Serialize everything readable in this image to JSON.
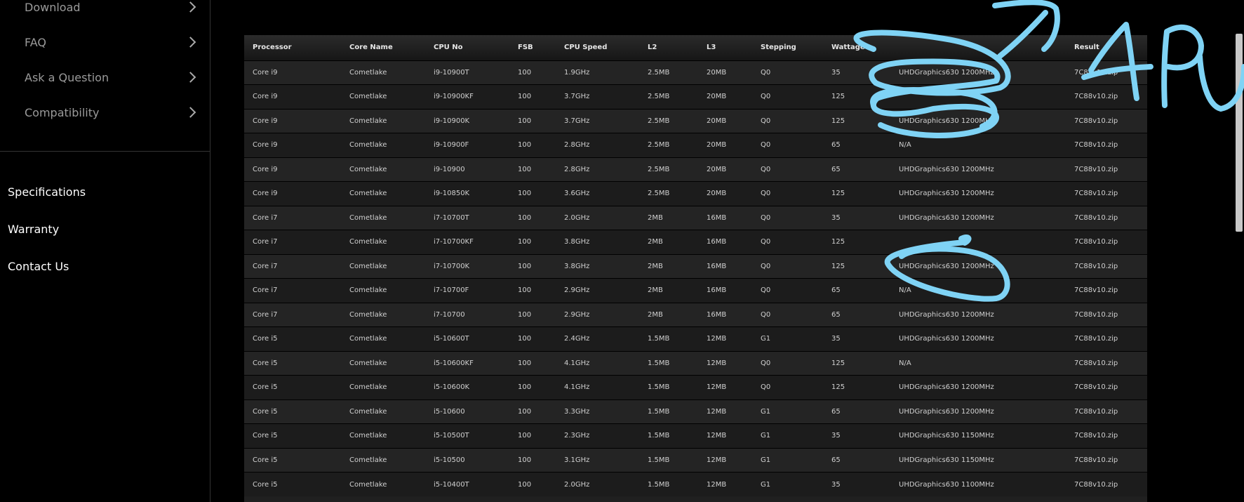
{
  "sidebar": {
    "menu": [
      {
        "label": "Download"
      },
      {
        "label": "FAQ"
      },
      {
        "label": "Ask a Question"
      },
      {
        "label": "Compatibility"
      }
    ],
    "links": [
      {
        "label": "Specifications"
      },
      {
        "label": "Warranty"
      },
      {
        "label": "Contact Us"
      }
    ]
  },
  "table": {
    "headers": [
      "Processor",
      "Core Name",
      "CPU No",
      "FSB",
      "CPU Speed",
      "L2",
      "L3",
      "Stepping",
      "Wattage",
      "",
      "Result"
    ],
    "rows": [
      [
        "Core i9",
        "Cometlake",
        "i9-10900T",
        "100",
        "1.9GHz",
        "2.5MB",
        "20MB",
        "Q0",
        "35",
        "UHDGraphics630 1200MHz",
        "7C88v10.zip"
      ],
      [
        "Core i9",
        "Cometlake",
        "i9-10900KF",
        "100",
        "3.7GHz",
        "2.5MB",
        "20MB",
        "Q0",
        "125",
        "",
        "7C88v10.zip"
      ],
      [
        "Core i9",
        "Cometlake",
        "i9-10900K",
        "100",
        "3.7GHz",
        "2.5MB",
        "20MB",
        "Q0",
        "125",
        "UHDGraphics630 1200MHz",
        "7C88v10.zip"
      ],
      [
        "Core i9",
        "Cometlake",
        "i9-10900F",
        "100",
        "2.8GHz",
        "2.5MB",
        "20MB",
        "Q0",
        "65",
        "N/A",
        "7C88v10.zip"
      ],
      [
        "Core i9",
        "Cometlake",
        "i9-10900",
        "100",
        "2.8GHz",
        "2.5MB",
        "20MB",
        "Q0",
        "65",
        "UHDGraphics630 1200MHz",
        "7C88v10.zip"
      ],
      [
        "Core i9",
        "Cometlake",
        "i9-10850K",
        "100",
        "3.6GHz",
        "2.5MB",
        "20MB",
        "Q0",
        "125",
        "UHDGraphics630 1200MHz",
        "7C88v10.zip"
      ],
      [
        "Core i7",
        "Cometlake",
        "i7-10700T",
        "100",
        "2.0GHz",
        "2MB",
        "16MB",
        "Q0",
        "35",
        "UHDGraphics630 1200MHz",
        "7C88v10.zip"
      ],
      [
        "Core i7",
        "Cometlake",
        "i7-10700KF",
        "100",
        "3.8GHz",
        "2MB",
        "16MB",
        "Q0",
        "125",
        "",
        "7C88v10.zip"
      ],
      [
        "Core i7",
        "Cometlake",
        "i7-10700K",
        "100",
        "3.8GHz",
        "2MB",
        "16MB",
        "Q0",
        "125",
        "UHDGraphics630 1200MHz",
        "7C88v10.zip"
      ],
      [
        "Core i7",
        "Cometlake",
        "i7-10700F",
        "100",
        "2.9GHz",
        "2MB",
        "16MB",
        "Q0",
        "65",
        "N/A",
        "7C88v10.zip"
      ],
      [
        "Core i7",
        "Cometlake",
        "i7-10700",
        "100",
        "2.9GHz",
        "2MB",
        "16MB",
        "Q0",
        "65",
        "UHDGraphics630 1200MHz",
        "7C88v10.zip"
      ],
      [
        "Core i5",
        "Cometlake",
        "i5-10600T",
        "100",
        "2.4GHz",
        "1.5MB",
        "12MB",
        "G1",
        "35",
        "UHDGraphics630 1200MHz",
        "7C88v10.zip"
      ],
      [
        "Core i5",
        "Cometlake",
        "i5-10600KF",
        "100",
        "4.1GHz",
        "1.5MB",
        "12MB",
        "Q0",
        "125",
        "N/A",
        "7C88v10.zip"
      ],
      [
        "Core i5",
        "Cometlake",
        "i5-10600K",
        "100",
        "4.1GHz",
        "1.5MB",
        "12MB",
        "Q0",
        "125",
        "UHDGraphics630 1200MHz",
        "7C88v10.zip"
      ],
      [
        "Core i5",
        "Cometlake",
        "i5-10600",
        "100",
        "3.3GHz",
        "1.5MB",
        "12MB",
        "G1",
        "65",
        "UHDGraphics630 1200MHz",
        "7C88v10.zip"
      ],
      [
        "Core i5",
        "Cometlake",
        "i5-10500T",
        "100",
        "2.3GHz",
        "1.5MB",
        "12MB",
        "G1",
        "35",
        "UHDGraphics630 1150MHz",
        "7C88v10.zip"
      ],
      [
        "Core i5",
        "Cometlake",
        "i5-10500",
        "100",
        "3.1GHz",
        "1.5MB",
        "12MB",
        "G1",
        "65",
        "UHDGraphics630 1150MHz",
        "7C88v10.zip"
      ],
      [
        "Core i5",
        "Cometlake",
        "i5-10400T",
        "100",
        "2.0GHz",
        "1.5MB",
        "12MB",
        "G1",
        "35",
        "UHDGraphics630 1100MHz",
        "7C88v10.zip"
      ]
    ]
  },
  "annotation": {
    "color": "#7fd3f5",
    "scribble_text": "APU"
  }
}
